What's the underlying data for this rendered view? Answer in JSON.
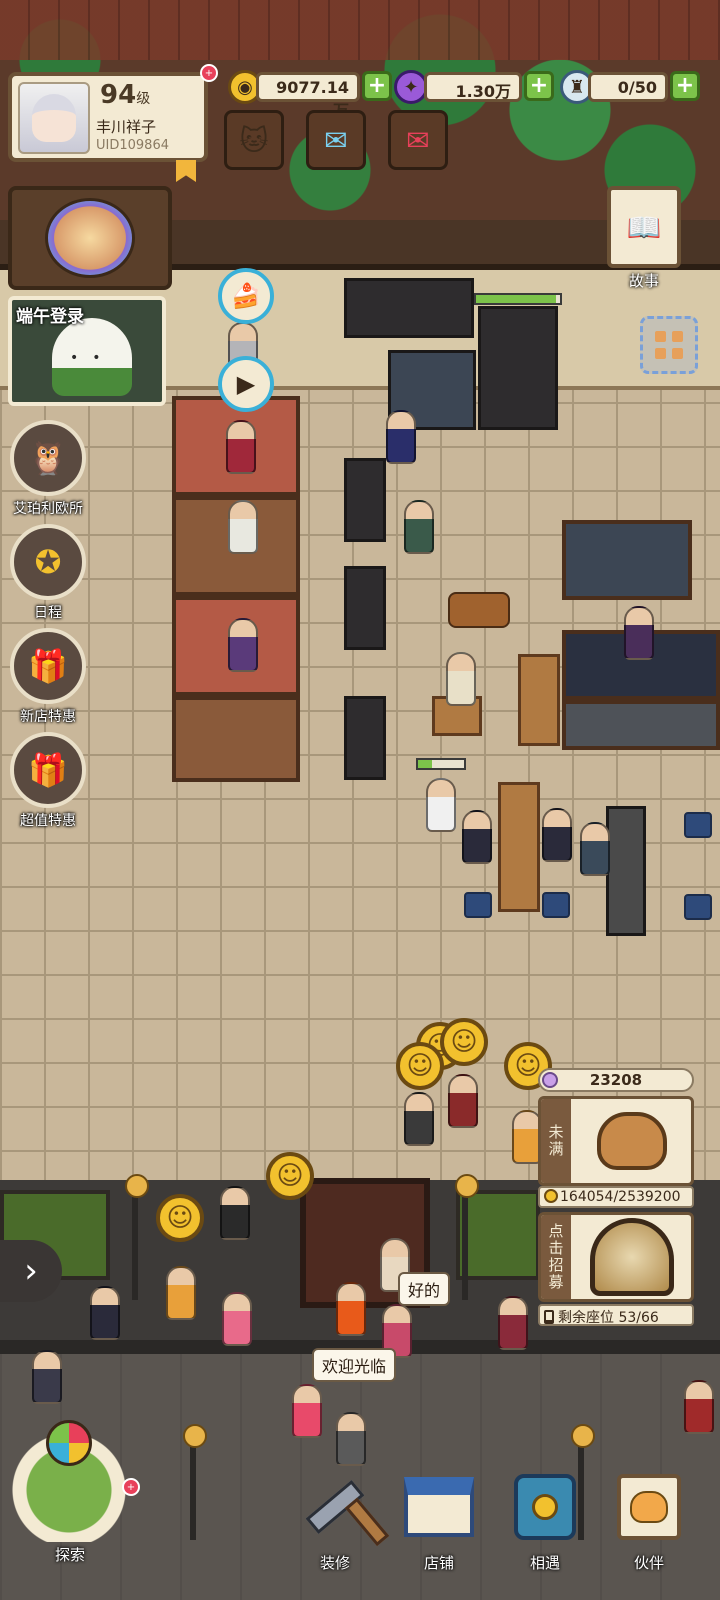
{
  "player": {
    "level": "94",
    "level_unit": "级",
    "name": "丰川祥子",
    "uid": "UID109864"
  },
  "resources": {
    "gold": "9077.14万",
    "gems": "1.30万",
    "bottles": "0/50"
  },
  "icons": {
    "gold": "coin-icon",
    "gems": "gem-egg-icon",
    "bottles": "bottle-icon",
    "cats": "cats-icon",
    "chat": "chat-bubbles-icon",
    "mail": "envelope-icon"
  },
  "event": {
    "title": "端午登录"
  },
  "sidebar": {
    "items": [
      {
        "label": "艾珀利欧所"
      },
      {
        "label": "日程"
      },
      {
        "label": "新店特惠"
      },
      {
        "label": "超值特惠"
      }
    ]
  },
  "story": {
    "label": "故事"
  },
  "shop": {
    "coin_count": "23208",
    "panel_status": "未满",
    "gold_progress": "164054/2539200",
    "recruit_label": "点击招募",
    "seats": "剩余座位 53/66"
  },
  "speech": {
    "npc_reply": "好的",
    "welcome": "欢迎光临"
  },
  "nav": {
    "explore": "探索",
    "renovate": "装修",
    "store": "店铺",
    "encounter": "相遇",
    "partner": "伙伴"
  },
  "colors": {
    "accent_green": "#7cc34a",
    "panel_bg": "#f3ead3",
    "panel_border": "#6b5236",
    "badge_red": "#e8405a",
    "smile_yellow": "#f2c12e"
  }
}
